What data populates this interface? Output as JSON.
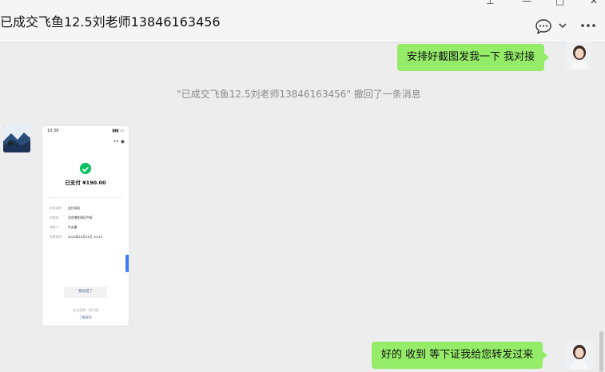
{
  "window": {
    "title": "已成交飞鱼12.5刘老师13846163456"
  },
  "header_icons": [
    "chat-bubble-icon",
    "chevron-down-icon",
    "more-icon"
  ],
  "messages": [
    {
      "side": "right",
      "text": "安排好截图发我一下 我对接"
    },
    {
      "side": "system",
      "text": "\"已成交飞鱼12.5刘老师13846163456\" 撤回了一条消息"
    },
    {
      "side": "left",
      "type": "image"
    },
    {
      "side": "right",
      "text": "好的 收到 等下证我给您转发过来"
    }
  ],
  "payment_screenshot": {
    "status_time": "10:36",
    "amount_text": "已支付 ¥190.00",
    "rows": [
      {
        "label": "交易说明",
        "value": "支付成功"
      },
      {
        "label": "付款给",
        "value": "北京博艺知识产权"
      },
      {
        "label": "收款人",
        "value": "牛志康"
      },
      {
        "label": "交易时间",
        "value": "2025年10月31日 10:35"
      }
    ],
    "button_label": "我知道了",
    "footer_text": "安全保障 · 财付通",
    "footer_link": "了解更多"
  },
  "colors": {
    "bubble_green": "#95ec69",
    "background": "#ededed",
    "pay_green": "#07c160"
  }
}
